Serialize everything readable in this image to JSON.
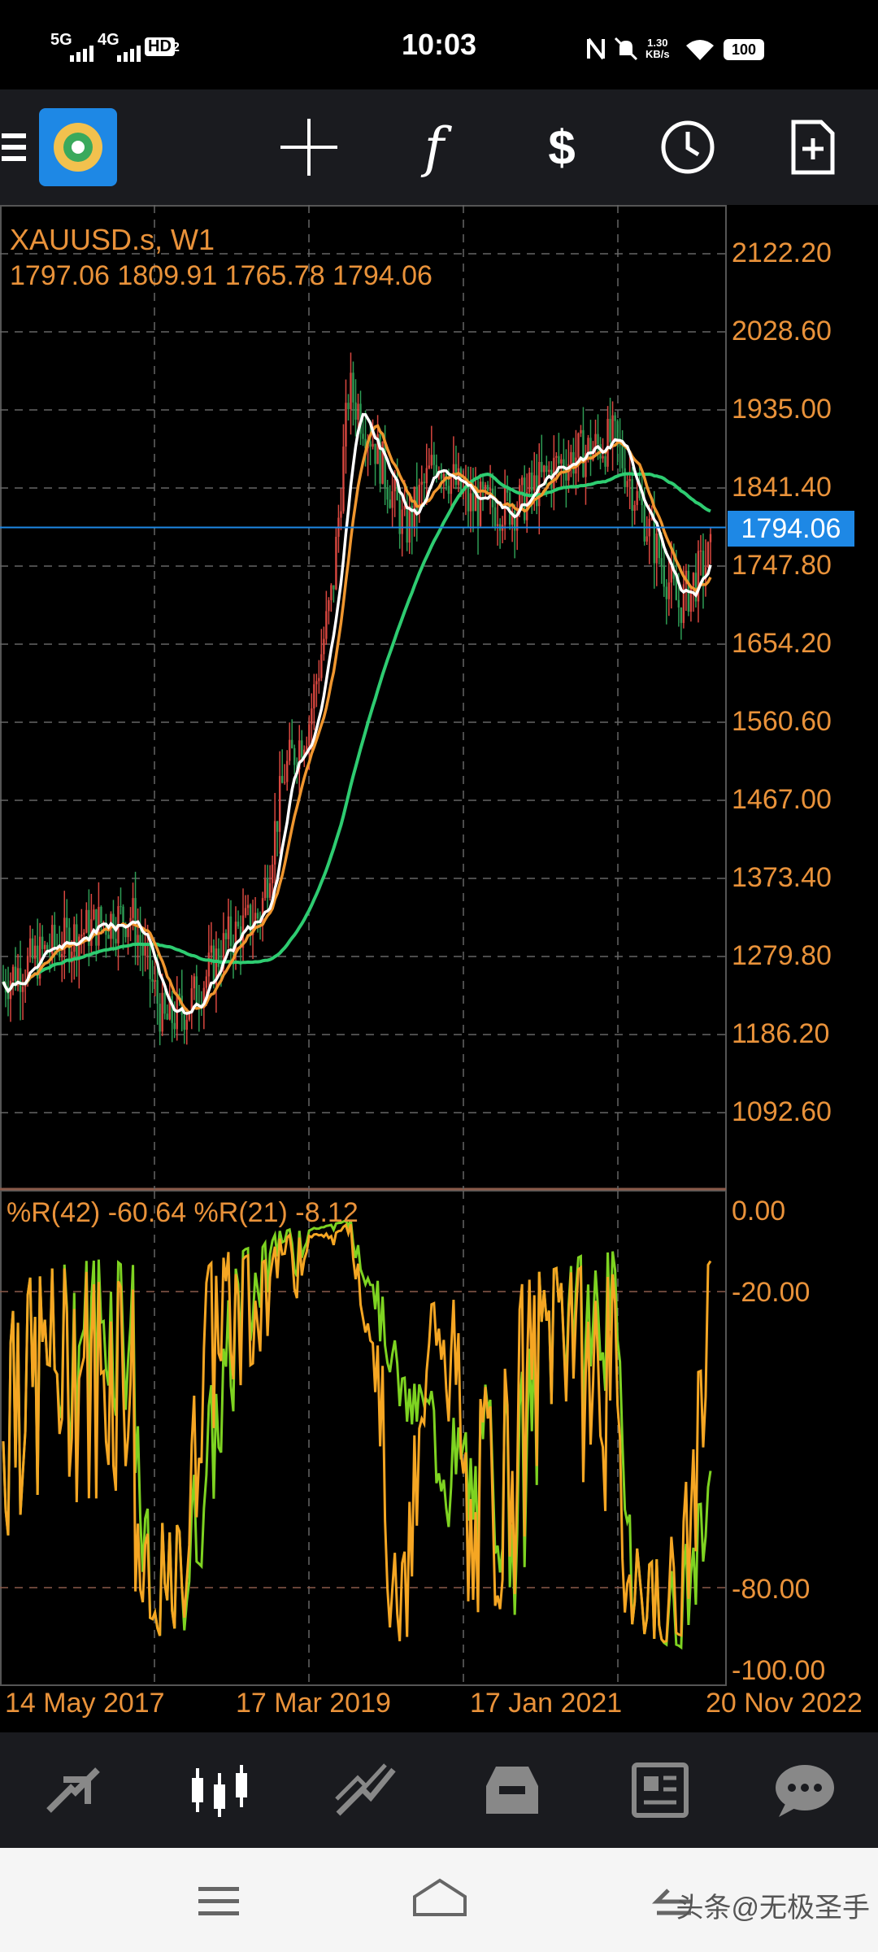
{
  "status_bar": {
    "time": "10:03",
    "signal_1": "5G",
    "signal_2": "4G",
    "hd": "HD",
    "hd_sub": "2",
    "net_speed_value": "1.30",
    "net_speed_unit": "KB/s",
    "battery": "100"
  },
  "toolbar": {
    "items": [
      "menu-icon",
      "app-logo",
      "crosshair-icon",
      "indicators-icon",
      "trade-icon",
      "timeframe-icon",
      "new-order-icon"
    ]
  },
  "chart": {
    "symbol_line": "XAUUSD.s, W1",
    "ohlc_line": "1797.06 1809.91 1765.78 1794.06",
    "current_price": "1794.06",
    "price_axis": [
      "2122.20",
      "2028.60",
      "1935.00",
      "1841.40",
      "1747.80",
      "1654.20",
      "1560.60",
      "1467.00",
      "1373.40",
      "1279.80",
      "1186.20",
      "1092.60"
    ],
    "indicator_label": "%R(42) -60.64 %R(21) -8.12",
    "indicator_axis": [
      "0.00",
      "-20.00",
      "-80.00",
      "-100.00"
    ],
    "date_axis": [
      "14 May 2017",
      "17 Mar 2019",
      "17 Jan 2021",
      "20 Nov 2022"
    ],
    "colors": {
      "axis_text": "#e9923a",
      "bull_candle": "#d8473f",
      "bear_candle": "#2e9c54",
      "ma_fast": "#ffffff",
      "ma_mid": "#f0962e",
      "ma_slow": "#2ecc71",
      "wpr42": "#7ed321",
      "wpr21": "#f5a623",
      "price_line": "#1e88e5"
    }
  },
  "chart_data": {
    "type": "line",
    "series": [
      {
        "name": "%R(42)",
        "last": -60.64
      },
      {
        "name": "%R(21)",
        "last": -8.12
      }
    ],
    "x": [
      "14 May 2017",
      "17 Mar 2019",
      "17 Jan 2021",
      "20 Nov 2022"
    ],
    "price_ylim": [
      1092.6,
      2122.2
    ],
    "price_last": 1794.06,
    "indicator_ylim": [
      -100,
      0
    ]
  },
  "bottom_nav": {
    "items": [
      "quotes-icon",
      "chart-icon",
      "trade-icon",
      "history-icon",
      "news-icon",
      "messages-icon"
    ],
    "active": "chart-icon"
  },
  "watermark": "头条@无极圣手"
}
